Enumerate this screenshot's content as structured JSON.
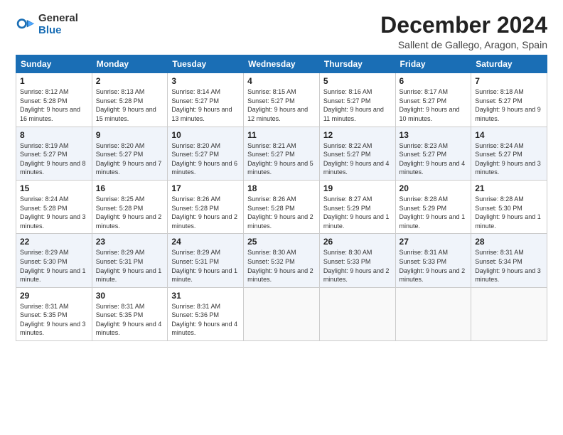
{
  "logo": {
    "general": "General",
    "blue": "Blue"
  },
  "title": "December 2024",
  "subtitle": "Sallent de Gallego, Aragon, Spain",
  "days_of_week": [
    "Sunday",
    "Monday",
    "Tuesday",
    "Wednesday",
    "Thursday",
    "Friday",
    "Saturday"
  ],
  "weeks": [
    [
      {
        "day": "1",
        "sunrise": "8:12 AM",
        "sunset": "5:28 PM",
        "daylight": "9 hours and 16 minutes."
      },
      {
        "day": "2",
        "sunrise": "8:13 AM",
        "sunset": "5:28 PM",
        "daylight": "9 hours and 15 minutes."
      },
      {
        "day": "3",
        "sunrise": "8:14 AM",
        "sunset": "5:27 PM",
        "daylight": "9 hours and 13 minutes."
      },
      {
        "day": "4",
        "sunrise": "8:15 AM",
        "sunset": "5:27 PM",
        "daylight": "9 hours and 12 minutes."
      },
      {
        "day": "5",
        "sunrise": "8:16 AM",
        "sunset": "5:27 PM",
        "daylight": "9 hours and 11 minutes."
      },
      {
        "day": "6",
        "sunrise": "8:17 AM",
        "sunset": "5:27 PM",
        "daylight": "9 hours and 10 minutes."
      },
      {
        "day": "7",
        "sunrise": "8:18 AM",
        "sunset": "5:27 PM",
        "daylight": "9 hours and 9 minutes."
      }
    ],
    [
      {
        "day": "8",
        "sunrise": "8:19 AM",
        "sunset": "5:27 PM",
        "daylight": "9 hours and 8 minutes."
      },
      {
        "day": "9",
        "sunrise": "8:20 AM",
        "sunset": "5:27 PM",
        "daylight": "9 hours and 7 minutes."
      },
      {
        "day": "10",
        "sunrise": "8:20 AM",
        "sunset": "5:27 PM",
        "daylight": "9 hours and 6 minutes."
      },
      {
        "day": "11",
        "sunrise": "8:21 AM",
        "sunset": "5:27 PM",
        "daylight": "9 hours and 5 minutes."
      },
      {
        "day": "12",
        "sunrise": "8:22 AM",
        "sunset": "5:27 PM",
        "daylight": "9 hours and 4 minutes."
      },
      {
        "day": "13",
        "sunrise": "8:23 AM",
        "sunset": "5:27 PM",
        "daylight": "9 hours and 4 minutes."
      },
      {
        "day": "14",
        "sunrise": "8:24 AM",
        "sunset": "5:27 PM",
        "daylight": "9 hours and 3 minutes."
      }
    ],
    [
      {
        "day": "15",
        "sunrise": "8:24 AM",
        "sunset": "5:28 PM",
        "daylight": "9 hours and 3 minutes."
      },
      {
        "day": "16",
        "sunrise": "8:25 AM",
        "sunset": "5:28 PM",
        "daylight": "9 hours and 2 minutes."
      },
      {
        "day": "17",
        "sunrise": "8:26 AM",
        "sunset": "5:28 PM",
        "daylight": "9 hours and 2 minutes."
      },
      {
        "day": "18",
        "sunrise": "8:26 AM",
        "sunset": "5:28 PM",
        "daylight": "9 hours and 2 minutes."
      },
      {
        "day": "19",
        "sunrise": "8:27 AM",
        "sunset": "5:29 PM",
        "daylight": "9 hours and 1 minute."
      },
      {
        "day": "20",
        "sunrise": "8:28 AM",
        "sunset": "5:29 PM",
        "daylight": "9 hours and 1 minute."
      },
      {
        "day": "21",
        "sunrise": "8:28 AM",
        "sunset": "5:30 PM",
        "daylight": "9 hours and 1 minute."
      }
    ],
    [
      {
        "day": "22",
        "sunrise": "8:29 AM",
        "sunset": "5:30 PM",
        "daylight": "9 hours and 1 minute."
      },
      {
        "day": "23",
        "sunrise": "8:29 AM",
        "sunset": "5:31 PM",
        "daylight": "9 hours and 1 minute."
      },
      {
        "day": "24",
        "sunrise": "8:29 AM",
        "sunset": "5:31 PM",
        "daylight": "9 hours and 1 minute."
      },
      {
        "day": "25",
        "sunrise": "8:30 AM",
        "sunset": "5:32 PM",
        "daylight": "9 hours and 2 minutes."
      },
      {
        "day": "26",
        "sunrise": "8:30 AM",
        "sunset": "5:33 PM",
        "daylight": "9 hours and 2 minutes."
      },
      {
        "day": "27",
        "sunrise": "8:31 AM",
        "sunset": "5:33 PM",
        "daylight": "9 hours and 2 minutes."
      },
      {
        "day": "28",
        "sunrise": "8:31 AM",
        "sunset": "5:34 PM",
        "daylight": "9 hours and 3 minutes."
      }
    ],
    [
      {
        "day": "29",
        "sunrise": "8:31 AM",
        "sunset": "5:35 PM",
        "daylight": "9 hours and 3 minutes."
      },
      {
        "day": "30",
        "sunrise": "8:31 AM",
        "sunset": "5:35 PM",
        "daylight": "9 hours and 4 minutes."
      },
      {
        "day": "31",
        "sunrise": "8:31 AM",
        "sunset": "5:36 PM",
        "daylight": "9 hours and 4 minutes."
      },
      null,
      null,
      null,
      null
    ]
  ],
  "labels": {
    "sunrise": "Sunrise:",
    "sunset": "Sunset:",
    "daylight": "Daylight:"
  }
}
